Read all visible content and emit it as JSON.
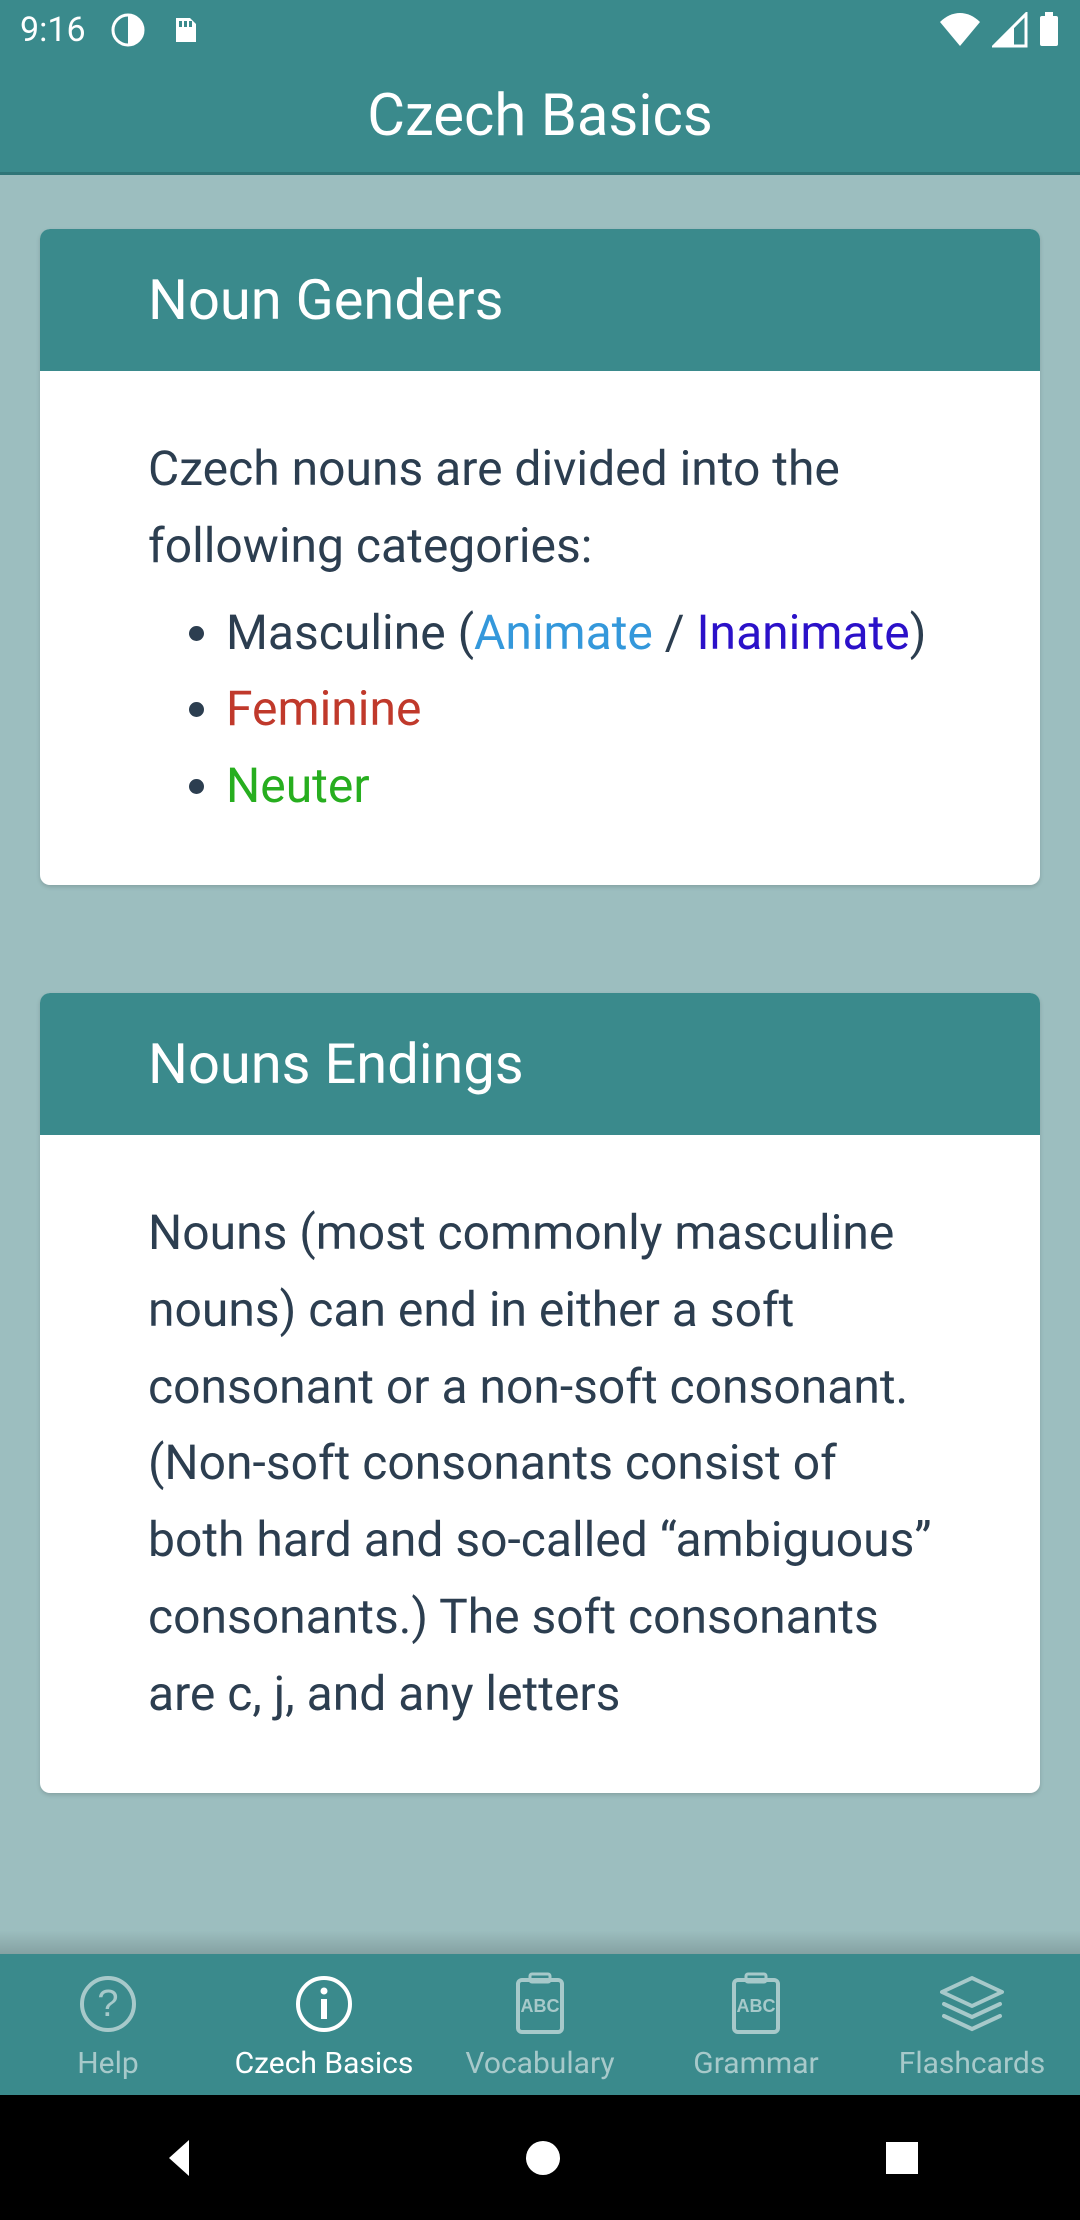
{
  "status": {
    "time": "9:16"
  },
  "header": {
    "title": "Czech Basics"
  },
  "card1": {
    "title": "Noun Genders",
    "intro": "Czech nouns are divided into the following categories:",
    "li1_pre": "Masculine (",
    "li1_animate": "Animate",
    "li1_sep": " / ",
    "li1_inanimate": "Inanimate",
    "li1_post": ")",
    "li2": "Feminine",
    "li3": "Neuter"
  },
  "card2": {
    "title": "Nouns Endings",
    "body": "Nouns (most commonly masculine nouns) can end in either a soft consonant or a non-soft consonant. (Non-soft consonants consist of both hard and so-called “ambiguous” consonants.) The soft consonants are c, j, and any letters"
  },
  "tabs": {
    "help": "Help",
    "basics": "Czech Basics",
    "vocab": "Vocabulary",
    "grammar": "Grammar",
    "flash": "Flashcards"
  }
}
